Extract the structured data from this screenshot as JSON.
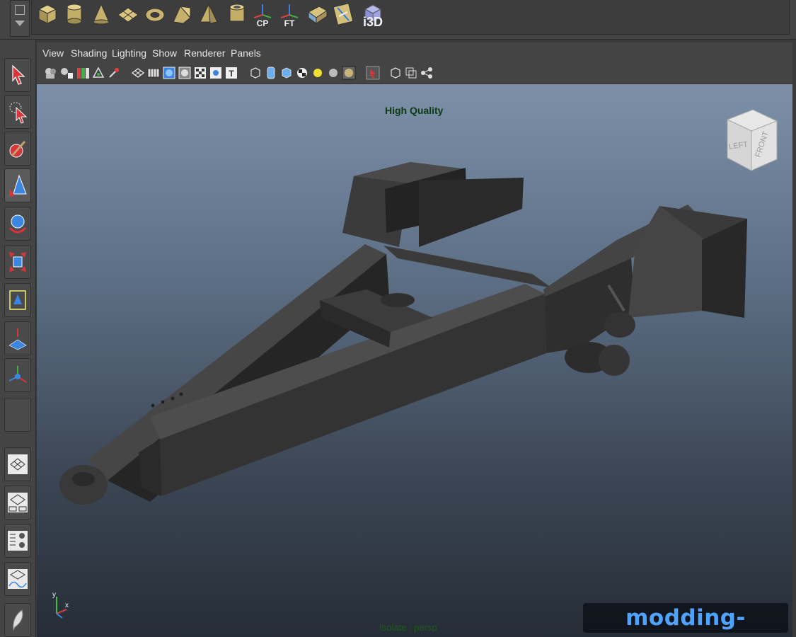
{
  "shelf": {
    "icons": [
      {
        "name": "poly-cube-icon"
      },
      {
        "name": "poly-cylinder-icon"
      },
      {
        "name": "poly-cone-icon"
      },
      {
        "name": "poly-plane-icon"
      },
      {
        "name": "poly-torus-icon"
      },
      {
        "name": "poly-prism-icon"
      },
      {
        "name": "poly-pyramid-icon"
      },
      {
        "name": "poly-pipe-icon"
      },
      {
        "name": "center-pivot-icon",
        "label": "CP"
      },
      {
        "name": "freeze-transform-icon",
        "label": "FT"
      },
      {
        "name": "uv-editor-icon"
      },
      {
        "name": "uv-layout-icon"
      },
      {
        "name": "i3d-export-icon",
        "label": "i3D"
      }
    ]
  },
  "panel_menu": [
    "View",
    "Shading",
    "Lighting",
    "Show",
    "Renderer",
    "Panels"
  ],
  "viewport": {
    "quality_label": "High Quality",
    "isolate_label": "Isolate : persp",
    "watermark": "modding-welt.com",
    "viewcube_left": "LEFT",
    "viewcube_front": "FRONT",
    "axis_y": "y",
    "axis_x": "x"
  },
  "colors": {
    "accent": "#4fa3ff",
    "hq_text": "#0c3a14",
    "panel_bg": "#444444"
  }
}
